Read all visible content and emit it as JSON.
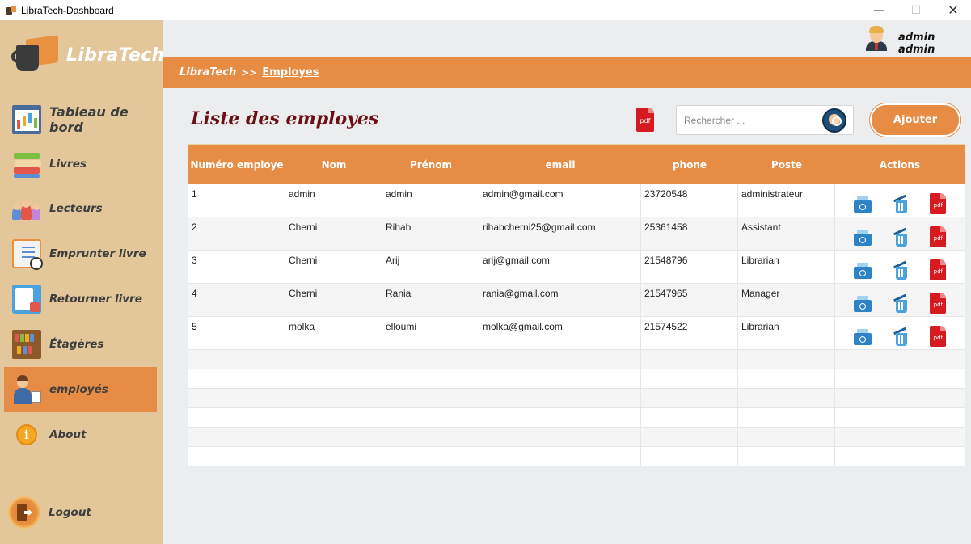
{
  "window": {
    "title": "LibraTech-Dashboard",
    "min_symbol": "—",
    "max_symbol": "☐",
    "close_symbol": "✕"
  },
  "brand": {
    "name": "LibraTech"
  },
  "sidebar": {
    "items": [
      {
        "label": "Tableau de bord",
        "icon": "dashboard-icon"
      },
      {
        "label": "Livres",
        "icon": "books-icon"
      },
      {
        "label": "Lecteurs",
        "icon": "readers-icon"
      },
      {
        "label": "Emprunter livre",
        "icon": "borrow-book-icon"
      },
      {
        "label": "Retourner livre",
        "icon": "return-book-icon"
      },
      {
        "label": "Étagères",
        "icon": "shelves-icon"
      },
      {
        "label": "employés",
        "icon": "employee-icon",
        "active": true
      },
      {
        "label": "About",
        "icon": "info-icon",
        "symbol": "i"
      }
    ],
    "logout": {
      "label": "Logout",
      "icon": "logout-icon"
    }
  },
  "header": {
    "username": "admin admin"
  },
  "breadcrumb": {
    "root": "LibraTech",
    "separator": ">>",
    "current": "Employes"
  },
  "page": {
    "title": "Liste des employes",
    "pdf_label": "pdf",
    "search_placeholder": "Rechercher ...",
    "add_label": "Ajouter"
  },
  "table": {
    "columns": [
      "Numéro employe",
      "Nom",
      "Prénom",
      "email",
      "phone",
      "Poste",
      "Actions"
    ],
    "rows": [
      [
        "1",
        "admin",
        "admin",
        "admin@gmail.com",
        "23720548",
        "administrateur"
      ],
      [
        "2",
        "Cherni",
        "Rihab",
        "rihabcherni25@gmail.com",
        "25361458",
        "Assistant"
      ],
      [
        "3",
        "Cherni",
        "Arij",
        "arij@gmail.com",
        "21548796",
        "Librarian"
      ],
      [
        "4",
        "Cherni",
        "Rania",
        "rania@gmail.com",
        "21547965",
        "Manager"
      ],
      [
        "5",
        "molka",
        "elloumi",
        "molka@gmail.com",
        "21574522",
        "Librarian"
      ]
    ],
    "row_actions": [
      "edit-icon",
      "delete-icon",
      "pdf-icon"
    ],
    "action_pdf_label": "pdf"
  },
  "colors": {
    "accent": "#e68c45",
    "sidebar_bg": "#e3c79a",
    "title": "#6b0f16",
    "pdf_red": "#d71920"
  }
}
